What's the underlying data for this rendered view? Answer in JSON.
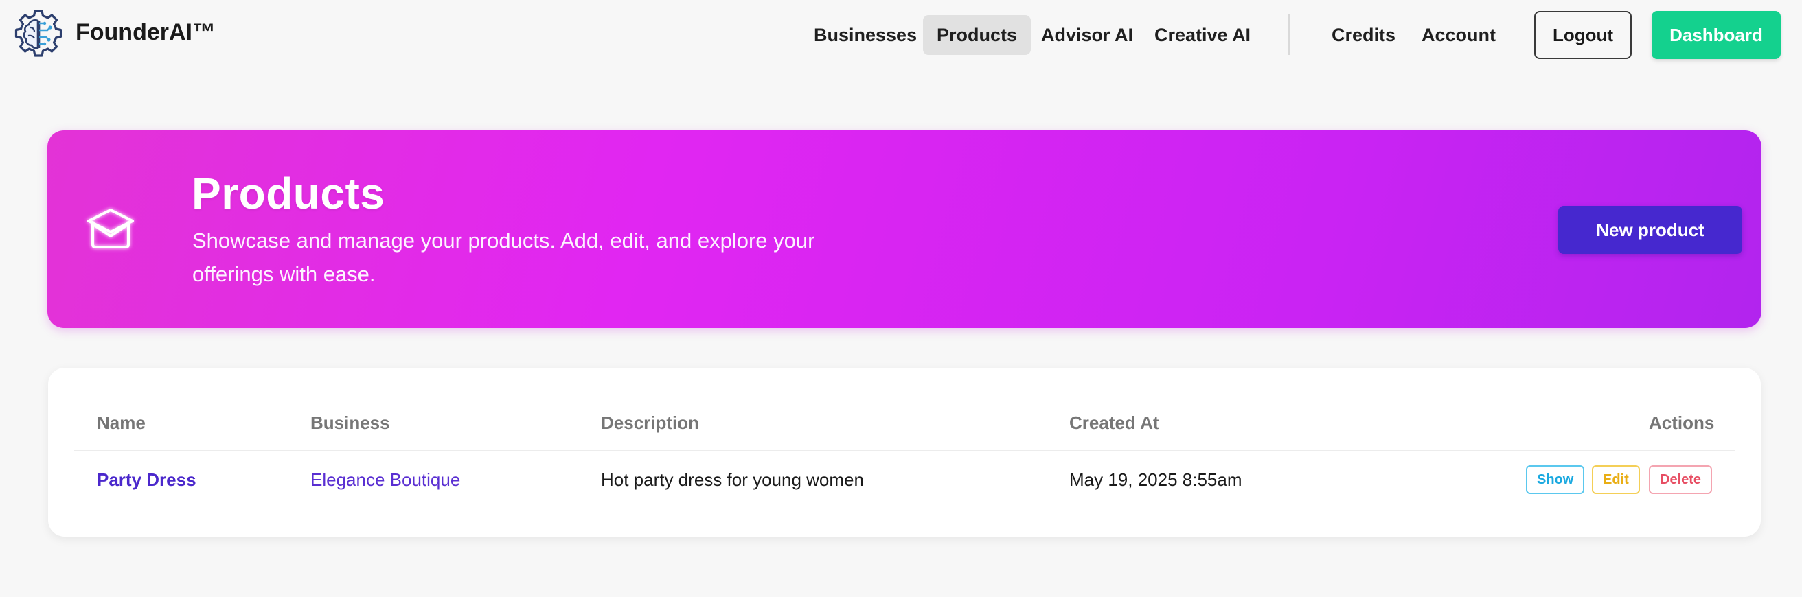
{
  "brand": {
    "name": "FounderAI™",
    "logo_icon": "gear-brain-icon"
  },
  "nav": {
    "links": [
      {
        "label": "Businesses",
        "active": false
      },
      {
        "label": "Products",
        "active": true
      },
      {
        "label": "Advisor AI",
        "active": false
      },
      {
        "label": "Creative AI",
        "active": false
      },
      {
        "label": "Credits",
        "active": false
      },
      {
        "label": "Account",
        "active": false
      }
    ],
    "logout_label": "Logout",
    "dashboard_label": "Dashboard"
  },
  "hero": {
    "icon": "graduation-cap-icon",
    "title": "Products",
    "subtitle": "Showcase and manage your products. Add, edit, and explore your offerings with ease.",
    "new_button_label": "New product"
  },
  "table": {
    "headers": {
      "name": "Name",
      "business": "Business",
      "description": "Description",
      "created_at": "Created At",
      "actions": "Actions"
    },
    "rows": [
      {
        "name": "Party Dress",
        "business": "Elegance Boutique",
        "description": "Hot party dress for young women",
        "created_at": "May 19, 2025 8:55am",
        "actions": {
          "show": "Show",
          "edit": "Edit",
          "delete": "Delete"
        }
      }
    ]
  },
  "colors": {
    "accent_green": "#14d18e",
    "hero_gradient_start": "#e333d6",
    "hero_gradient_end": "#b224ee",
    "primary_button": "#4628cf",
    "link": "#4b28cc",
    "show": "#1aa9e0",
    "edit": "#e9ae15",
    "delete": "#e74e63"
  }
}
